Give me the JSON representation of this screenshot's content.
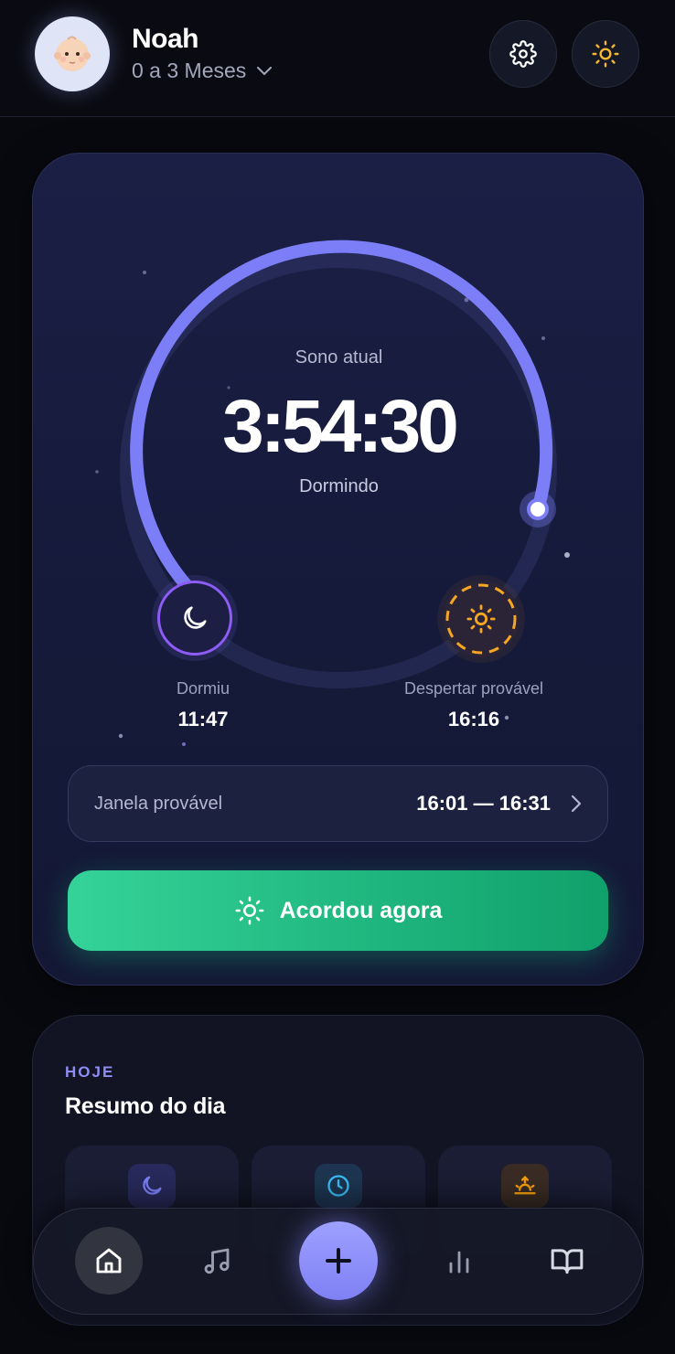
{
  "profile": {
    "name": "Noah",
    "age_range": "0 a 3 Meses"
  },
  "header": {
    "settings_icon": "gear-icon",
    "theme_icon": "sun-icon"
  },
  "sleep": {
    "label": "Sono atual",
    "timer": "3:54:30",
    "status": "Dormindo",
    "slept_label": "Dormiu",
    "slept_time": "11:47",
    "wake_label": "Despertar provável",
    "wake_time": "16:16",
    "window_label": "Janela provável",
    "window_range": "16:01 — 16:31",
    "wake_button": "Acordou agora",
    "accent_color": "#7b7ef6",
    "slept_color": "#8d5cf6",
    "wake_color": "#f5a623"
  },
  "summary": {
    "kicker": "HOJE",
    "title": "Resumo do dia",
    "tiles": [
      {
        "icon": "moon-icon",
        "color": "#7b7ef6"
      },
      {
        "icon": "clock-icon",
        "color": "#38bdf8"
      },
      {
        "icon": "sunrise-icon",
        "color": "#f59e0b"
      }
    ]
  },
  "nav": {
    "items": [
      "home-icon",
      "music-icon",
      "plus-icon",
      "stats-icon",
      "book-icon"
    ]
  },
  "colors": {
    "primary_button": "#22c58a",
    "background": "#08090f"
  }
}
